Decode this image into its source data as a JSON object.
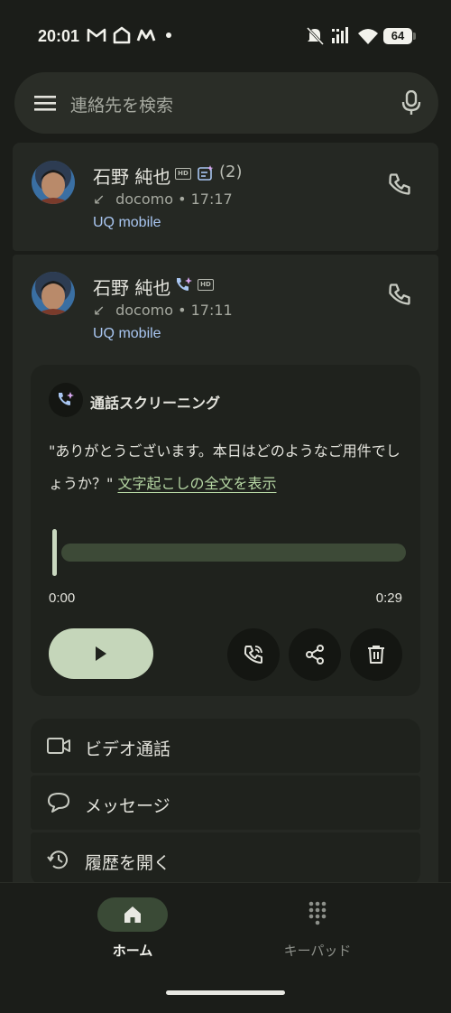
{
  "status_bar": {
    "time": "20:01",
    "battery": "64",
    "notification_icons": [
      "gmail-icon",
      "home-icon",
      "mail-icon",
      "dot"
    ],
    "system_icons": [
      "mute-icon",
      "signal-icon",
      "wifi-icon",
      "battery-icon"
    ]
  },
  "search": {
    "placeholder": "連絡先を検索"
  },
  "call_log": [
    {
      "name": "石野 純也",
      "badges": [
        "hd-icon",
        "transcript-icon"
      ],
      "count": "(2)",
      "carrier_line": "docomo • 17:17",
      "line": "UQ mobile"
    },
    {
      "name": "石野 純也",
      "badges": [
        "call-screening-icon",
        "hd-icon"
      ],
      "carrier_line": "docomo • 17:11",
      "line": "UQ mobile"
    }
  ],
  "screening": {
    "title": "通話スクリーニング",
    "transcript": "\"ありがとうございます。本日はどのようなご用件でしょうか？\"",
    "link": "文字起こしの全文を表示",
    "time_start": "0:00",
    "time_end": "0:29",
    "progress": 0
  },
  "actions": [
    {
      "label": "ビデオ通話",
      "icon": "video-icon"
    },
    {
      "label": "メッセージ",
      "icon": "message-icon"
    },
    {
      "label": "履歴を開く",
      "icon": "history-icon"
    }
  ],
  "nav": {
    "home": "ホーム",
    "keypad": "キーパッド"
  },
  "colors": {
    "background": "#1b1d19",
    "card": "#252823",
    "link_blue": "#a9c6f1",
    "link_green": "#b6d7a4",
    "play_button": "#c5d6ba",
    "nav_active": "#3a4a36"
  }
}
